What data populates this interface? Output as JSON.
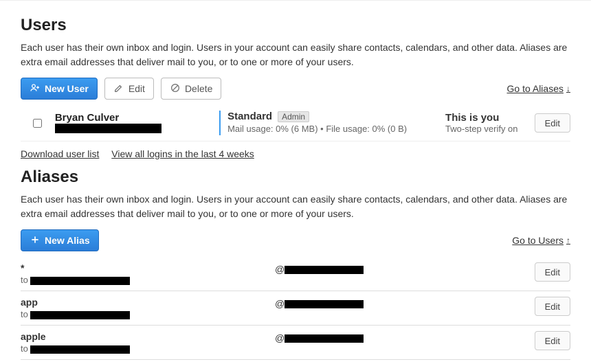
{
  "users": {
    "title": "Users",
    "desc": "Each user has their own inbox and login. Users in your account can easily share contacts, calendars, and other data. Aliases are extra email addresses that deliver mail to you, or to one or more of your users.",
    "new_user_label": "New User",
    "edit_label": "Edit",
    "delete_label": "Delete",
    "go_aliases": "Go to Aliases",
    "go_aliases_arrow": "↓",
    "rows": [
      {
        "name": "Bryan Culver",
        "plan": "Standard",
        "admin_badge": "Admin",
        "usage": "Mail usage: 0% (6 MB) • File usage: 0% (0 B)",
        "this_is_you": "This is you",
        "two_step": "Two-step verify on",
        "edit": "Edit"
      }
    ],
    "download_list": "Download user list",
    "view_logins": "View all logins in the last 4 weeks"
  },
  "aliases": {
    "title": "Aliases",
    "desc": "Each user has their own inbox and login. Users in your account can easily share contacts, calendars, and other data. Aliases are extra email addresses that deliver mail to you, or to one or more of your users.",
    "new_alias_label": "New Alias",
    "go_users": "Go to Users",
    "go_users_arrow": "↑",
    "at": "@",
    "to_prefix": "to  ",
    "edit_label": "Edit",
    "rows": [
      {
        "local": "*"
      },
      {
        "local": "app"
      },
      {
        "local": "apple"
      }
    ]
  }
}
